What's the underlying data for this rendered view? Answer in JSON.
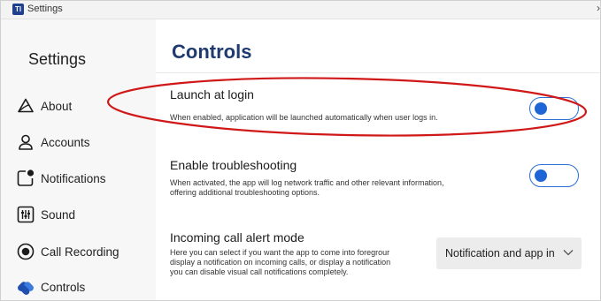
{
  "window": {
    "title": "Settings",
    "app_icon_glyph": "Tl"
  },
  "sidebar": {
    "title": "Settings",
    "items": [
      {
        "label": "About",
        "icon": "warning-triangle-icon"
      },
      {
        "label": "Accounts",
        "icon": "person-icon"
      },
      {
        "label": "Notifications",
        "icon": "notification-badge-icon"
      },
      {
        "label": "Sound",
        "icon": "equalizer-icon"
      },
      {
        "label": "Call Recording",
        "icon": "record-icon"
      },
      {
        "label": "Controls",
        "icon": "controls-icon",
        "active": true
      }
    ]
  },
  "main": {
    "title": "Controls",
    "settings": [
      {
        "name": "Launch at login",
        "description": "When enabled, application will be launched automatically when user logs in.",
        "control": "toggle",
        "state": "off"
      },
      {
        "name": "Enable troubleshooting",
        "description_lines": [
          "When activated, the app will log network traffic and other relevant information,",
          "offering additional troubleshooting options."
        ],
        "control": "toggle",
        "state": "off"
      },
      {
        "name": "Incoming call alert mode",
        "description_lines": [
          "Here you can select if you want the app to come into foregrour",
          "display a notification on incoming calls, or display a notification",
          "you can disable visual call notifications completely."
        ],
        "control": "dropdown",
        "selected": "Notification and app int"
      }
    ]
  },
  "colors": {
    "accent": "#1f65d6",
    "title": "#1e3a6e",
    "annotation": "#d01818",
    "sidebar_bg": "#f7f7f7"
  }
}
